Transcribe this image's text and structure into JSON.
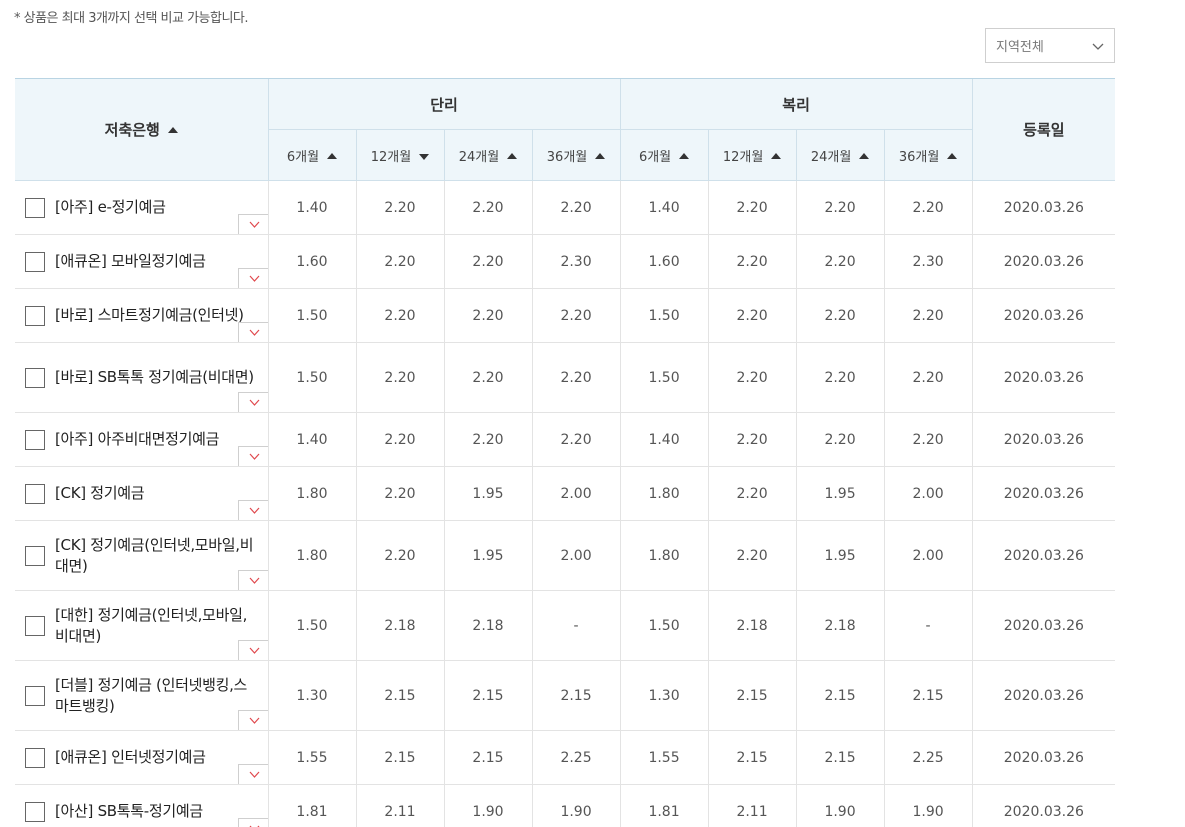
{
  "notice": "* 상품은 최대 3개까지 선택 비교 가능합니다.",
  "region_select": {
    "value": "지역전체",
    "icon": "chevron-down-icon"
  },
  "header": {
    "bank_col": "저축은행",
    "simple_group": "단리",
    "compound_group": "복리",
    "date_col": "등록일",
    "terms": [
      "6개월",
      "12개월",
      "24개월",
      "36개월"
    ],
    "simple_sort": [
      "up",
      "down",
      "up",
      "up"
    ],
    "compound_sort": [
      "up",
      "up",
      "up",
      "up"
    ]
  },
  "rows": [
    {
      "name": "[아주] e-정기예금",
      "simple": [
        "1.40",
        "2.20",
        "2.20",
        "2.20"
      ],
      "compound": [
        "1.40",
        "2.20",
        "2.20",
        "2.20"
      ],
      "date": "2020.03.26"
    },
    {
      "name": "[애큐온] 모바일정기예금",
      "simple": [
        "1.60",
        "2.20",
        "2.20",
        "2.30"
      ],
      "compound": [
        "1.60",
        "2.20",
        "2.20",
        "2.30"
      ],
      "date": "2020.03.26"
    },
    {
      "name": "[바로] 스마트정기예금(인터넷)",
      "simple": [
        "1.50",
        "2.20",
        "2.20",
        "2.20"
      ],
      "compound": [
        "1.50",
        "2.20",
        "2.20",
        "2.20"
      ],
      "date": "2020.03.26"
    },
    {
      "name": "[바로] SB톡톡 정기예금(비대면)",
      "simple": [
        "1.50",
        "2.20",
        "2.20",
        "2.20"
      ],
      "compound": [
        "1.50",
        "2.20",
        "2.20",
        "2.20"
      ],
      "date": "2020.03.26"
    },
    {
      "name": "[아주] 아주비대면정기예금",
      "simple": [
        "1.40",
        "2.20",
        "2.20",
        "2.20"
      ],
      "compound": [
        "1.40",
        "2.20",
        "2.20",
        "2.20"
      ],
      "date": "2020.03.26"
    },
    {
      "name": "[CK] 정기예금",
      "simple": [
        "1.80",
        "2.20",
        "1.95",
        "2.00"
      ],
      "compound": [
        "1.80",
        "2.20",
        "1.95",
        "2.00"
      ],
      "date": "2020.03.26"
    },
    {
      "name": "[CK] 정기예금(인터넷,모바일,비대면)",
      "simple": [
        "1.80",
        "2.20",
        "1.95",
        "2.00"
      ],
      "compound": [
        "1.80",
        "2.20",
        "1.95",
        "2.00"
      ],
      "date": "2020.03.26"
    },
    {
      "name": "[대한] 정기예금(인터넷,모바일,비대면)",
      "simple": [
        "1.50",
        "2.18",
        "2.18",
        "-"
      ],
      "compound": [
        "1.50",
        "2.18",
        "2.18",
        "-"
      ],
      "date": "2020.03.26"
    },
    {
      "name": "[더블] 정기예금 (인터넷뱅킹,스마트뱅킹)",
      "simple": [
        "1.30",
        "2.15",
        "2.15",
        "2.15"
      ],
      "compound": [
        "1.30",
        "2.15",
        "2.15",
        "2.15"
      ],
      "date": "2020.03.26"
    },
    {
      "name": "[애큐온] 인터넷정기예금",
      "simple": [
        "1.55",
        "2.15",
        "2.15",
        "2.25"
      ],
      "compound": [
        "1.55",
        "2.15",
        "2.15",
        "2.25"
      ],
      "date": "2020.03.26"
    },
    {
      "name": "[아산] SB톡톡-정기예금",
      "simple": [
        "1.81",
        "2.11",
        "1.90",
        "1.90"
      ],
      "compound": [
        "1.81",
        "2.11",
        "1.90",
        "1.90"
      ],
      "date": "2020.03.26"
    }
  ],
  "colors": {
    "header_bg": "#eef6fa",
    "expand_arrow": "#e0484d"
  }
}
